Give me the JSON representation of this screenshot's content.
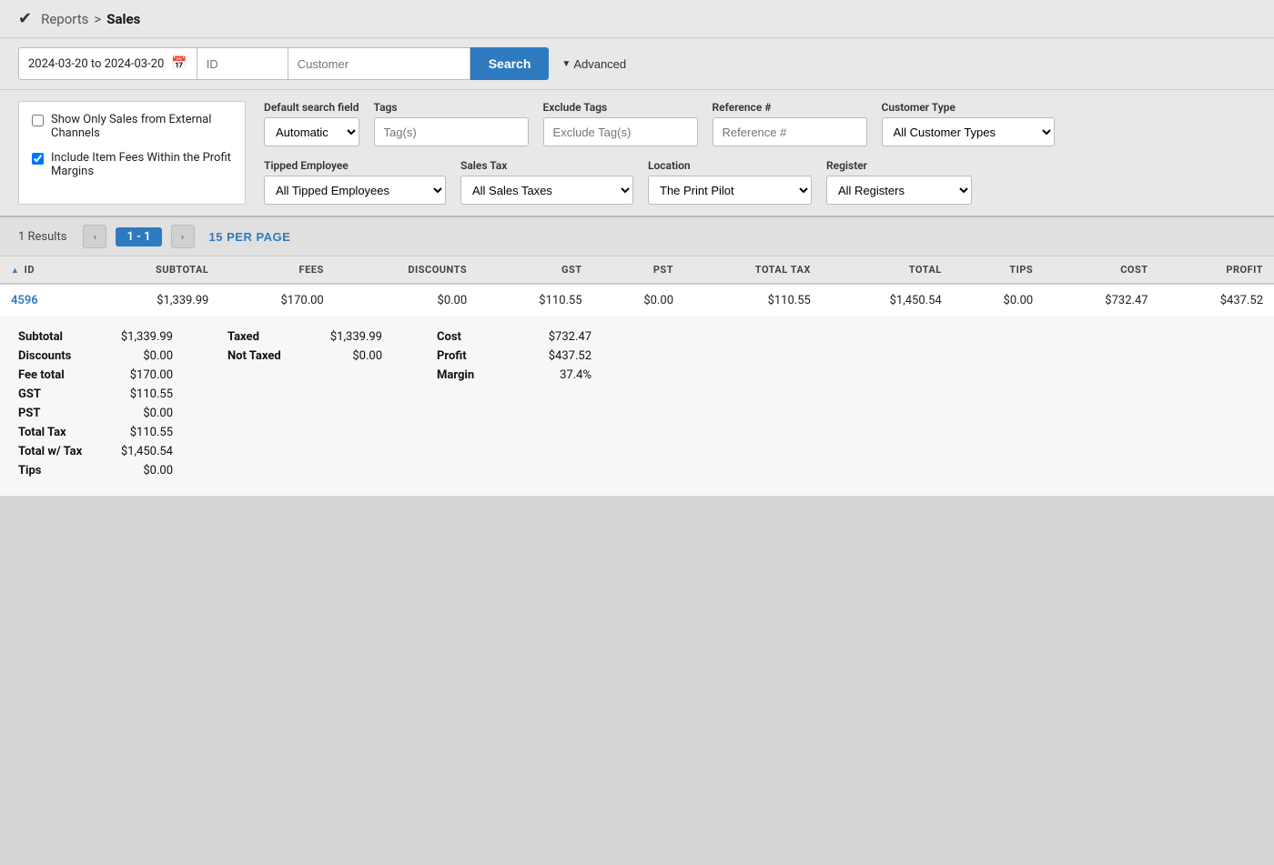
{
  "header": {
    "logo": "✔",
    "breadcrumb_parent": "Reports",
    "breadcrumb_separator": ">",
    "breadcrumb_current": "Sales"
  },
  "searchbar": {
    "date_range": "2024-03-20 to 2024-03-20",
    "id_placeholder": "ID",
    "customer_placeholder": "Customer",
    "search_label": "Search",
    "advanced_label": "Advanced"
  },
  "filters": {
    "checkboxes": [
      {
        "label": "Show Only Sales from External Channels",
        "checked": false
      },
      {
        "label": "Include Item Fees Within the Profit Margins",
        "checked": true
      }
    ],
    "default_search_field": {
      "label": "Default search field",
      "options": [
        "Automatic"
      ],
      "selected": "Automatic"
    },
    "tags": {
      "label": "Tags",
      "placeholder": "Tag(s)"
    },
    "exclude_tags": {
      "label": "Exclude Tags",
      "placeholder": "Exclude Tag(s)"
    },
    "reference": {
      "label": "Reference #",
      "placeholder": "Reference #"
    },
    "customer_type": {
      "label": "Customer Type",
      "options": [
        "All Customer Types"
      ],
      "selected": "All Customer Types"
    },
    "tipped_employee": {
      "label": "Tipped Employee",
      "options": [
        "All Tipped Employees"
      ],
      "selected": "All Tipped Employees"
    },
    "sales_tax": {
      "label": "Sales Tax",
      "options": [
        "All Sales Taxes"
      ],
      "selected": "All Sales Taxes"
    },
    "location": {
      "label": "Location",
      "options": [
        "The Print Pilot"
      ],
      "selected": "The Print Pilot"
    },
    "register": {
      "label": "Register",
      "options": [
        "All Registers"
      ],
      "selected": "All Registers"
    }
  },
  "pagination": {
    "results_count": "1 Results",
    "page_prev": "‹",
    "page_indicator": "1 - 1",
    "page_next": "›",
    "per_page": "15 PER PAGE"
  },
  "table": {
    "columns": [
      "ID",
      "SUBTOTAL",
      "FEES",
      "DISCOUNTS",
      "GST",
      "PST",
      "TOTAL TAX",
      "TOTAL",
      "TIPS",
      "COST",
      "PROFIT"
    ],
    "rows": [
      {
        "id": "4596",
        "subtotal": "$1,339.99",
        "fees": "$170.00",
        "discounts": "$0.00",
        "gst": "$110.55",
        "pst": "$0.00",
        "total_tax": "$110.55",
        "total": "$1,450.54",
        "tips": "$0.00",
        "cost": "$732.47",
        "profit": "$437.52"
      }
    ]
  },
  "detail": {
    "left_col": [
      {
        "label": "Subtotal",
        "value": "$1,339.99"
      },
      {
        "label": "Discounts",
        "value": "$0.00"
      },
      {
        "label": "Fee total",
        "value": "$170.00"
      },
      {
        "label": "GST",
        "value": "$110.55"
      },
      {
        "label": "PST",
        "value": "$0.00"
      },
      {
        "label": "Total Tax",
        "value": "$110.55"
      },
      {
        "label": "Total w/ Tax",
        "value": "$1,450.54"
      },
      {
        "label": "Tips",
        "value": "$0.00"
      }
    ],
    "mid_col": [
      {
        "label": "Taxed",
        "value": "$1,339.99"
      },
      {
        "label": "Not Taxed",
        "value": "$0.00"
      }
    ],
    "right_col": [
      {
        "label": "Cost",
        "value": "$732.47"
      },
      {
        "label": "Profit",
        "value": "$437.52"
      },
      {
        "label": "Margin",
        "value": "37.4%"
      }
    ]
  }
}
